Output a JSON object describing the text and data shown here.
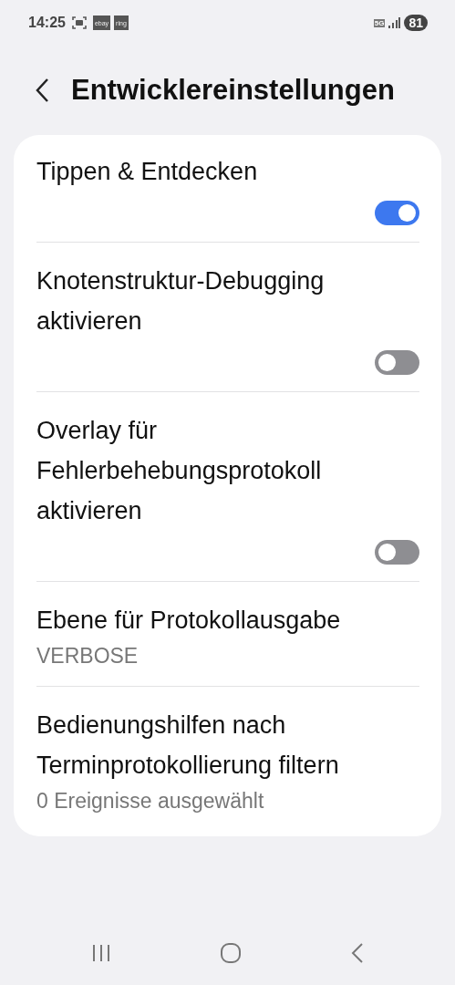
{
  "status_bar": {
    "time": "14:25",
    "notifications": [
      "ebay",
      "ring"
    ],
    "network": "5G",
    "battery": "81"
  },
  "header": {
    "title": "Entwicklereinstellungen"
  },
  "settings": [
    {
      "kind": "toggle",
      "title": "Tippen & Entdecken",
      "on": true
    },
    {
      "kind": "toggle",
      "title": "Knotenstruktur-Debugging aktivieren",
      "on": false
    },
    {
      "kind": "toggle",
      "title": "Overlay für Fehlerbehebungsprotokoll aktivieren",
      "on": false
    },
    {
      "kind": "value",
      "title": "Ebene für Protokollausgabe",
      "value": "VERBOSE"
    },
    {
      "kind": "value",
      "title": "Bedienungshilfen nach Terminprotokollierung filtern",
      "value": "0 Ereignisse ausgewählt"
    }
  ]
}
